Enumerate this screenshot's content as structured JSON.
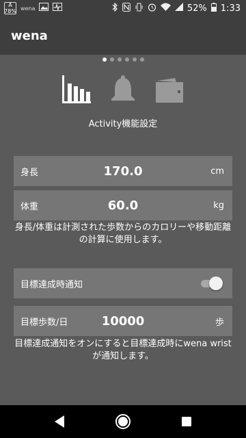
{
  "status_bar": {
    "badge_top": "A",
    "badge_bottom": "78%",
    "wena_label": "wena",
    "battery": "52%",
    "time": "1:33"
  },
  "app_bar": {
    "title": "wena"
  },
  "pager": {
    "total": 6,
    "active": 0
  },
  "section": {
    "title": "Activity機能設定"
  },
  "height_row": {
    "label": "身長",
    "value": "170.0",
    "unit": "cm"
  },
  "weight_row": {
    "label": "体重",
    "value": "60.0",
    "unit": "kg"
  },
  "body_note": "身長/体重は計測された歩数からのカロリーや移動距離の計算に使用します。",
  "goal_notify_row": {
    "label": "目標達成時通知",
    "enabled": true
  },
  "goal_steps_row": {
    "label": "目標歩数/日",
    "value": "10000",
    "unit": "歩"
  },
  "goal_note": "目標達成通知をオンにすると目標達成時にwena wristが通知します。",
  "colors": {
    "background": "#5a5a5a",
    "bar": "#3e3e3e",
    "row": "#767676"
  },
  "icons": [
    "activity-bars-icon",
    "bell-icon",
    "wallet-icon"
  ]
}
